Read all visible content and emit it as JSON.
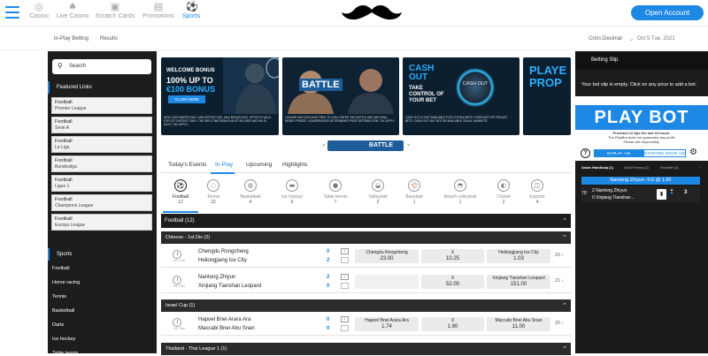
{
  "header": {
    "nav": [
      {
        "label": "Casino",
        "icon": "casino-chip-icon"
      },
      {
        "label": "Live Casino",
        "icon": "live-casino-icon"
      },
      {
        "label": "Scratch Cards",
        "icon": "scratch-card-icon"
      },
      {
        "label": "Promotions",
        "icon": "gift-icon"
      },
      {
        "label": "Sports",
        "icon": "football-icon",
        "active": true
      }
    ],
    "logo": "mustache-logo",
    "open_account": "Open Account"
  },
  "subbar": {
    "inplay": "In-Play Betting",
    "results": "Results",
    "odds_label": "Odds:",
    "odds_value": "Decimal",
    "date": "Oct 5 Tue, 2021"
  },
  "sidebar": {
    "search_placeholder": "Search",
    "featured_title": "Featured Links",
    "featured": [
      {
        "sport": "Football",
        "league": "Premier League"
      },
      {
        "sport": "Football",
        "league": "Serie A"
      },
      {
        "sport": "Football",
        "league": "La Liga"
      },
      {
        "sport": "Football",
        "league": "Bundesliga"
      },
      {
        "sport": "Football",
        "league": "Ligue 1"
      },
      {
        "sport": "Football",
        "league": "Champions League"
      },
      {
        "sport": "Football",
        "league": "Europa League"
      }
    ],
    "sports_title": "Sports",
    "sports": [
      "Football",
      "Horse racing",
      "Tennis",
      "Basketball",
      "Darts",
      "Ice hockey",
      "Table tennis"
    ]
  },
  "banners": {
    "b1": {
      "line1": "WELCOME BONUS",
      "line2a": "100% UP TO",
      "line3": "€100 BONUS",
      "claim": "CLAIM HERE",
      "fine": "NEW CUSTOMERS ONLY. MIN DEPOSIT €20. MAX BONUS €100. OFFER IS VALID FOR 1ST DEPOSIT ONLY. THE WELCOME BONUS MUST BE USED WITHIN 30 DAYS. T&C APPLY."
    },
    "b2": {
      "title": "BATTLE",
      "fine": "LONGER MATCHES ARE FREE TO JOIN. ENTER THE BATTLE AND WIN REAL MONEY PRIZES. LEADERBOARD DETERMINES PRIZE DISTRIBUTION. T&C APPLY."
    },
    "b3": {
      "title1": "CASH",
      "title2": "OUT",
      "tag1": "TAKE",
      "tag2": "CONTROL OF",
      "tag3": "YOUR BET",
      "orb": "CASH OUT",
      "fine": "CASH OUT IS NOT AVAILABLE FOR SYSTEM BETS. FORECAST OR TRICAST BETS. CASH OUT MAY NOT BE AVAILABLE ON ALL MARKETS."
    },
    "b4": {
      "line1": "PLAYE",
      "line2": "PROP"
    }
  },
  "battle_label": "BATTLE",
  "tabs": [
    {
      "label": "Today's Events"
    },
    {
      "label": "In-Play",
      "active": true
    },
    {
      "label": "Upcoming"
    },
    {
      "label": "Highlights"
    }
  ],
  "sports_filter": [
    {
      "name": "Football",
      "count": "12",
      "icon": "football-icon",
      "active": true
    },
    {
      "name": "Tennis",
      "count": "22",
      "icon": "tennis-ball-icon"
    },
    {
      "name": "Basketball",
      "count": "4",
      "icon": "basketball-icon"
    },
    {
      "name": "Ice hockey",
      "count": "6",
      "icon": "ice-hockey-icon"
    },
    {
      "name": "Table tennis",
      "count": "7",
      "icon": "table-tennis-icon"
    },
    {
      "name": "Volleyball",
      "count": "2",
      "icon": "volleyball-icon"
    },
    {
      "name": "Baseball",
      "count": "1",
      "icon": "baseball-icon"
    },
    {
      "name": "Beach volleyball",
      "count": "1",
      "icon": "beach-volleyball-icon"
    },
    {
      "name": "Cricket",
      "count": "2",
      "icon": "cricket-icon"
    },
    {
      "name": "Esports",
      "count": "4",
      "icon": "gamepad-icon"
    }
  ],
  "list_header": "Football  (12)",
  "competitions": [
    {
      "name": "Chinese - 1st Div (2)",
      "matches": [
        {
          "time": "H2 71m",
          "home": "Chengdu Rongcheng",
          "away": "Heilongjiang Ice City",
          "score_home": "0",
          "score_away": "2",
          "odds": [
            {
              "label": "Chengdu Rongcheng",
              "value": "23.00"
            },
            {
              "label": "X",
              "value": "10.25"
            },
            {
              "label": "Heilongjiang Ice City",
              "value": "1.03"
            }
          ],
          "more": "20"
        },
        {
          "time": "H2 73m",
          "home": "Nantong Zhiyun",
          "away": "Xinjiang Tianshan Leopard",
          "score_home": "2",
          "score_away": "0",
          "odds": [
            {
              "label": "",
              "value": ""
            },
            {
              "label": "X",
              "value": "52.00"
            },
            {
              "label": "Xinjiang Tianshan Leopard",
              "value": "151.00"
            }
          ],
          "more": "21"
        }
      ]
    },
    {
      "name": "Israel Cup (1)",
      "matches": [
        {
          "time": "H2 75m",
          "home": "Hapoel Bnei Arara Ara",
          "away": "Maccabi Bnei Abu Snan",
          "score_home": "0",
          "score_away": "0",
          "odds": [
            {
              "label": "Hapoel Bnei Arara Ara",
              "value": "1.74"
            },
            {
              "label": "X",
              "value": "1.90"
            },
            {
              "label": "Maccabi Bnei Abu Snan",
              "value": "11.00"
            }
          ],
          "more": "20"
        }
      ]
    },
    {
      "name": "Thailand - Thai League 1 (1)",
      "matches": []
    }
  ],
  "betslip": {
    "title": "Betting Slip",
    "empty": "Your bet slip is empty. Click on any price to add a bet.",
    "playbot": "PLAY BOT",
    "pb_fine1": "Provided 12 tips the last 24 hours.",
    "pb_fine2": "The PlayBot does not guarantee any profit.",
    "pb_fine3": "Please bet responsibly.",
    "inplay_btn": "IN-PLAY +15",
    "starting_btn": "STARTING SOON +28",
    "subtabs": [
      "Asian Handicap (1)",
      "Goal Frenzy (1)",
      "Favorite (1)"
    ],
    "match_title": "Nantong Zhiyun -0.5 @ 1.82",
    "minute": "70'",
    "team1": "2 Nantong Zhiyun",
    "team2": "0 Xinjiang Tianshan ..",
    "score": "3"
  }
}
